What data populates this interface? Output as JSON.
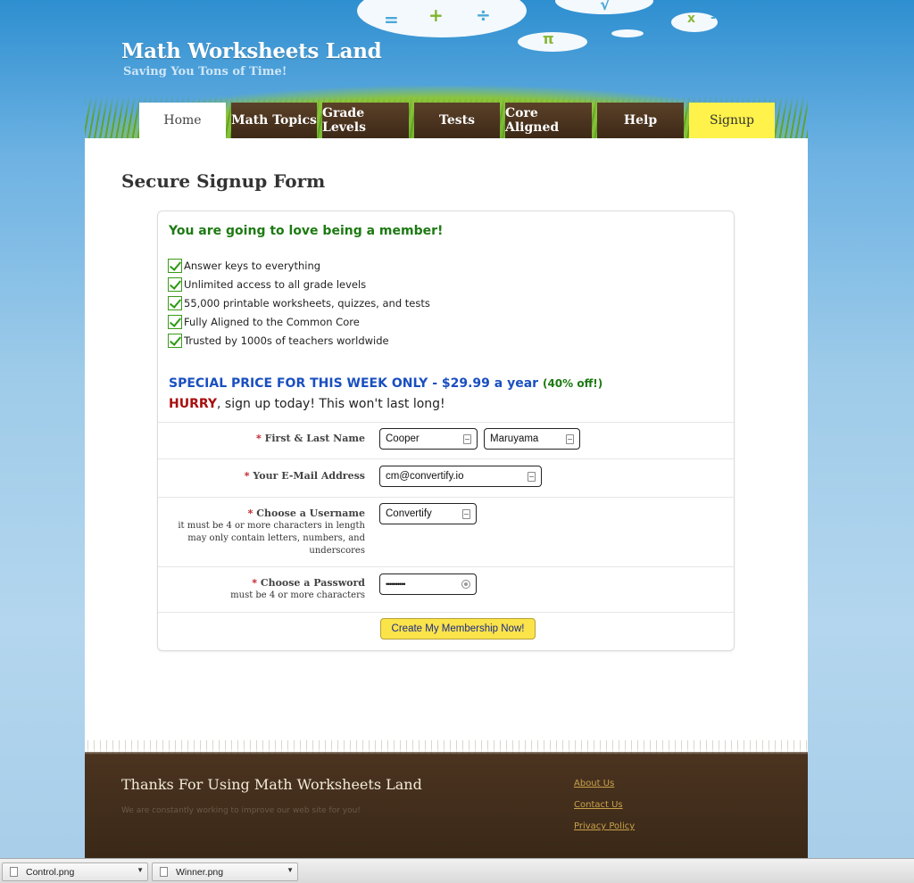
{
  "header": {
    "site_title": "Math Worksheets Land",
    "tagline": "Saving You Tons of Time!",
    "symbols": {
      "equals": "=",
      "plus": "+",
      "divide": "÷",
      "pi": "π",
      "sqrt": "√",
      "times": "x",
      "minus": "-"
    }
  },
  "nav": {
    "items": [
      {
        "label": "Home"
      },
      {
        "label": "Math Topics"
      },
      {
        "label": "Grade Levels"
      },
      {
        "label": "Tests"
      },
      {
        "label": "Core Aligned"
      },
      {
        "label": "Help"
      },
      {
        "label": "Signup"
      }
    ]
  },
  "page": {
    "title": "Secure Signup Form"
  },
  "promo": {
    "headline": "You are going to love being a member!",
    "benefits": [
      "Answer keys to everything",
      "Unlimited access to all grade levels",
      "55,000 printable worksheets, quizzes, and tests",
      "Fully Aligned to the Common Core",
      "Trusted by 1000s of teachers worldwide"
    ],
    "special": "SPECIAL PRICE FOR THIS WEEK ONLY - $29.99 a year",
    "discount": "(40% off!)",
    "hurry_word": "HURRY",
    "hurry_rest": ", sign up today! This won't last long!"
  },
  "form": {
    "required_mark": "*",
    "name_label": "First & Last Name",
    "first_name": "Cooper",
    "last_name": "Maruyama",
    "email_label": "Your E-Mail Address",
    "email": "cm@convertify.io",
    "username_label": "Choose a Username",
    "username_hint_1": "it must be 4 or more characters in length",
    "username_hint_2": "may only contain letters, numbers, and",
    "username_hint_3": "underscores",
    "username": "Convertify",
    "password_label": "Choose a Password",
    "password_hint": "must be 4 or more characters",
    "password_mask": "••••••••••",
    "submit_label": "Create My Membership Now!"
  },
  "footer": {
    "title": "Thanks For Using Math Worksheets Land",
    "subtitle": "We are constantly working to improve our web site for you!",
    "links": [
      "About Us",
      "Contact Us",
      "Privacy Policy"
    ]
  },
  "downloads": {
    "items": [
      {
        "name": "Control.png"
      },
      {
        "name": "Winner.png"
      }
    ],
    "arrow": "▼"
  },
  "colors": {
    "nav_brown": "#4a3320",
    "signup_yellow": "#fff24a",
    "headline_green": "#1d7a12",
    "special_blue": "#1a4fc0",
    "hurry_red": "#a80f0f",
    "button_yellow": "#fbe34a",
    "footer_brown": "#3a2817"
  }
}
